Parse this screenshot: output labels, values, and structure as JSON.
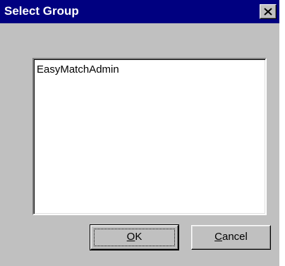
{
  "window": {
    "title": "Select Group",
    "close_icon": "close-icon"
  },
  "groups": {
    "items": [
      "EasyMatchAdmin"
    ]
  },
  "buttons": {
    "ok": {
      "mnemonic": "O",
      "rest": "K"
    },
    "cancel": {
      "mnemonic": "C",
      "rest": "ancel"
    }
  },
  "colors": {
    "titlebar": "#000080",
    "face": "#c0c0c0",
    "list_bg": "#ffffff"
  }
}
